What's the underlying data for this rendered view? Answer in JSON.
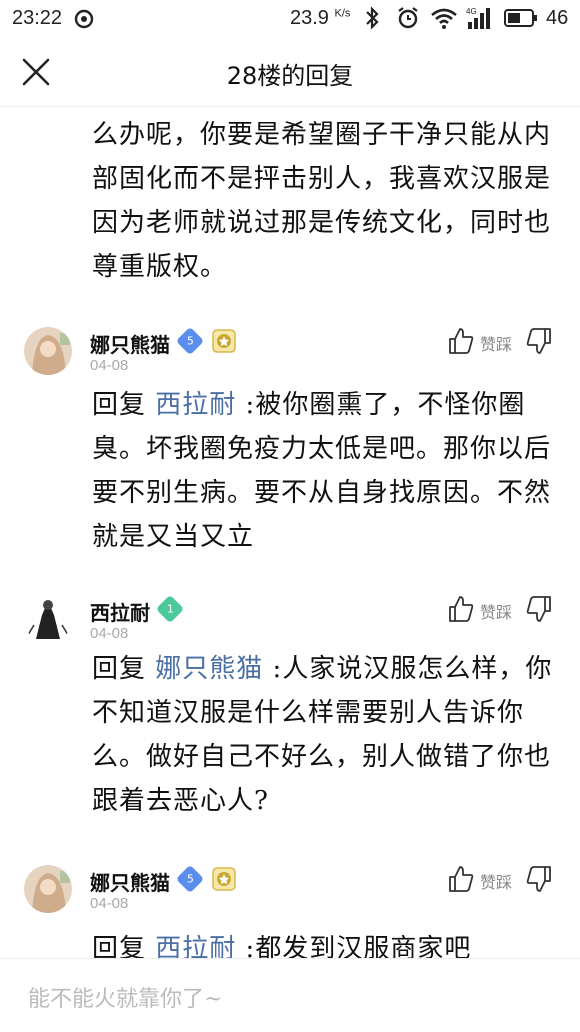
{
  "status_bar": {
    "time": "23:22",
    "net_speed": "23.9",
    "net_speed_unit": "K/s",
    "signal_type": "4G",
    "battery": "46"
  },
  "header": {
    "title": "28楼的回复"
  },
  "post_text": "么办呢，你要是希望圈子干净只能从内部固化而不是抨击别人，我喜欢汉服是因为老师就说过那是传统文化，同时也尊重版权。",
  "comments": [
    {
      "username": "娜只熊猫",
      "level": "5",
      "level_color": "#5b8def",
      "has_medal": true,
      "date": "04-08",
      "vote_label": "赞踩",
      "reply_prefix": "回复",
      "reply_target": "西拉耐",
      "text": " :被你圈熏了，不怪你圈臭。坏我圈免疫力太低是吧。那你以后要不别生病。要不从自身找原因。不然就是又当又立"
    },
    {
      "username": "西拉耐",
      "level": "1",
      "level_color": "#4cc99a",
      "has_medal": false,
      "date": "04-08",
      "vote_label": "赞踩",
      "reply_prefix": "回复",
      "reply_target": "娜只熊猫",
      "text": " :人家说汉服怎么样，你不知道汉服是什么样需要别人告诉你么。做好自己不好么，别人做错了你也跟着去恶心人?"
    },
    {
      "username": "娜只熊猫",
      "level": "5",
      "level_color": "#5b8def",
      "has_medal": true,
      "date": "04-08",
      "vote_label": "赞踩",
      "reply_prefix": "回复",
      "reply_target": "西拉耐",
      "text": " :都发到汉服商家吧"
    }
  ],
  "input": {
    "placeholder": "能不能火就靠你了~"
  },
  "colors": {
    "link": "#4a6fa5",
    "muted": "#aaaaaa"
  }
}
